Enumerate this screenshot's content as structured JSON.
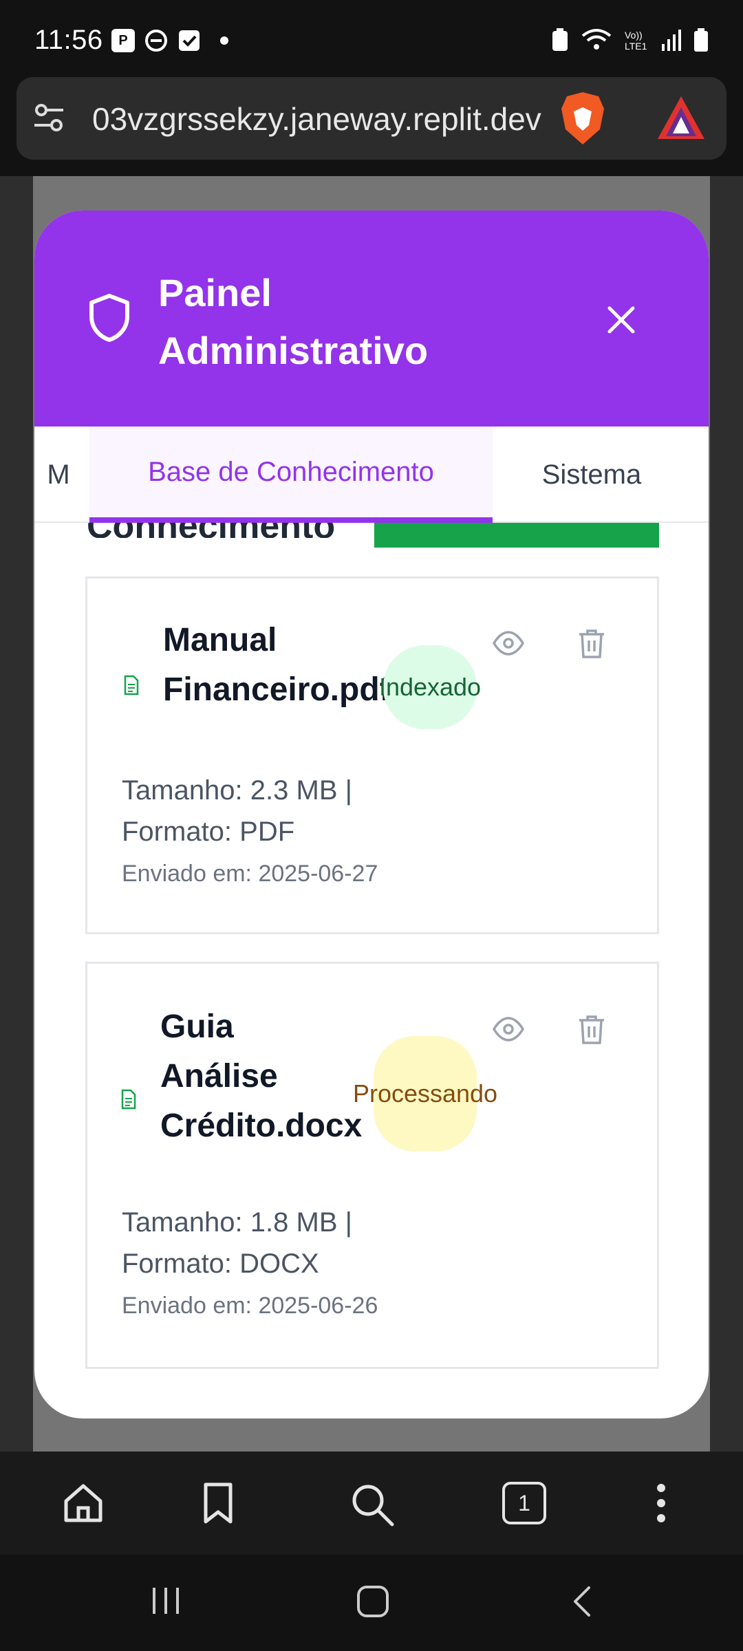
{
  "status_bar": {
    "time": "11:56"
  },
  "browser": {
    "url": "03vzgrssekzy.janeway.replit.dev"
  },
  "modal": {
    "title": "Painel Administrativo",
    "tabs": [
      {
        "label": "M"
      },
      {
        "label": "Base de Conhecimento",
        "active": true
      },
      {
        "label": "Sistema"
      }
    ],
    "peek_heading": "Conhecimento",
    "documents": [
      {
        "name": "Manual Financeiro.pdf",
        "status": "Indexado",
        "size_format": "Tamanho: 2.3 MB | Formato: PDF",
        "uploaded": "Enviado em: 2025-06-27"
      },
      {
        "name": "Guia Análise Crédito.docx",
        "status": "Processando",
        "size_format": "Tamanho: 1.8 MB | Formato: DOCX",
        "uploaded": "Enviado em: 2025-06-26"
      }
    ]
  },
  "bottom_nav": {
    "tab_count": "1"
  },
  "colors": {
    "accent": "#9333ea",
    "indexed": "#dcfce7",
    "processing": "#fef9c3",
    "success": "#16a34a"
  }
}
